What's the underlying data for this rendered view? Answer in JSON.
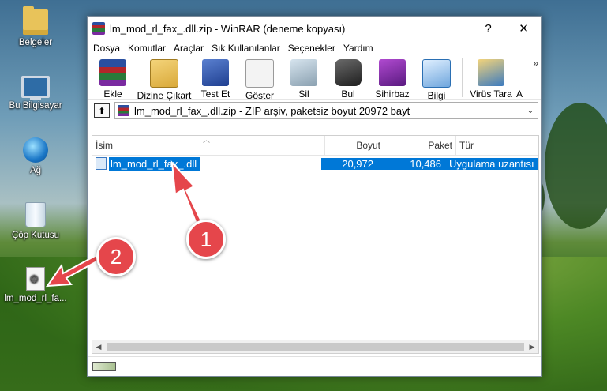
{
  "desktop": {
    "icons": [
      {
        "label": "Belgeler",
        "icon": "folder-icon"
      },
      {
        "label": "Bu Bilgisayar",
        "icon": "computer-icon"
      },
      {
        "label": "Ağ",
        "icon": "network-icon"
      },
      {
        "label": "Çöp Kutusu",
        "icon": "recycle-bin-icon"
      },
      {
        "label": "lm_mod_rl_fa...",
        "icon": "dll-file-icon"
      }
    ]
  },
  "window": {
    "title": "lm_mod_rl_fax_.dll.zip - WinRAR (deneme kopyası)",
    "help": "?",
    "close": "✕"
  },
  "menu": [
    "Dosya",
    "Komutlar",
    "Araçlar",
    "Sık Kullanılanlar",
    "Seçenekler",
    "Yardım"
  ],
  "toolbar": {
    "buttons": [
      {
        "label": "Ekle",
        "icon": "add-archive-icon",
        "color": "#7a2aa0"
      },
      {
        "label": "Dizine Çıkart",
        "icon": "extract-folder-icon",
        "color": "#d9a93a"
      },
      {
        "label": "Test Et",
        "icon": "test-icon",
        "color": "#2a4fa0"
      },
      {
        "label": "Göster",
        "icon": "view-icon",
        "color": "#9a9a9a"
      },
      {
        "label": "Sil",
        "icon": "delete-icon",
        "color": "#c0392b"
      },
      {
        "label": "Bul",
        "icon": "find-icon",
        "color": "#3d3d3d"
      },
      {
        "label": "Sihirbaz",
        "icon": "wizard-icon",
        "color": "#7a2aa0"
      },
      {
        "label": "Bilgi",
        "icon": "info-icon",
        "color": "#2a6fb3"
      },
      {
        "label": "Virüs Tara",
        "icon": "virus-scan-icon",
        "color": "#d9a93a"
      },
      {
        "label": "A",
        "icon": "comment-icon",
        "color": "#888888"
      }
    ],
    "more": "»"
  },
  "address": {
    "up": "⬆",
    "text": "lm_mod_rl_fax_.dll.zip - ZIP arşiv, paketsiz boyut 20972 bayt",
    "dropdown": "⌄"
  },
  "columns": {
    "name": "İsim",
    "size": "Boyut",
    "packed": "Paket",
    "type": "Tür"
  },
  "files": [
    {
      "name": "lm_mod_rl_fax_.dll",
      "size": "20,972",
      "packed": "10,486",
      "type": "Uygulama uzantısı"
    }
  ],
  "annotations": {
    "step1": "1",
    "step2": "2",
    "color": "#e5464b"
  }
}
